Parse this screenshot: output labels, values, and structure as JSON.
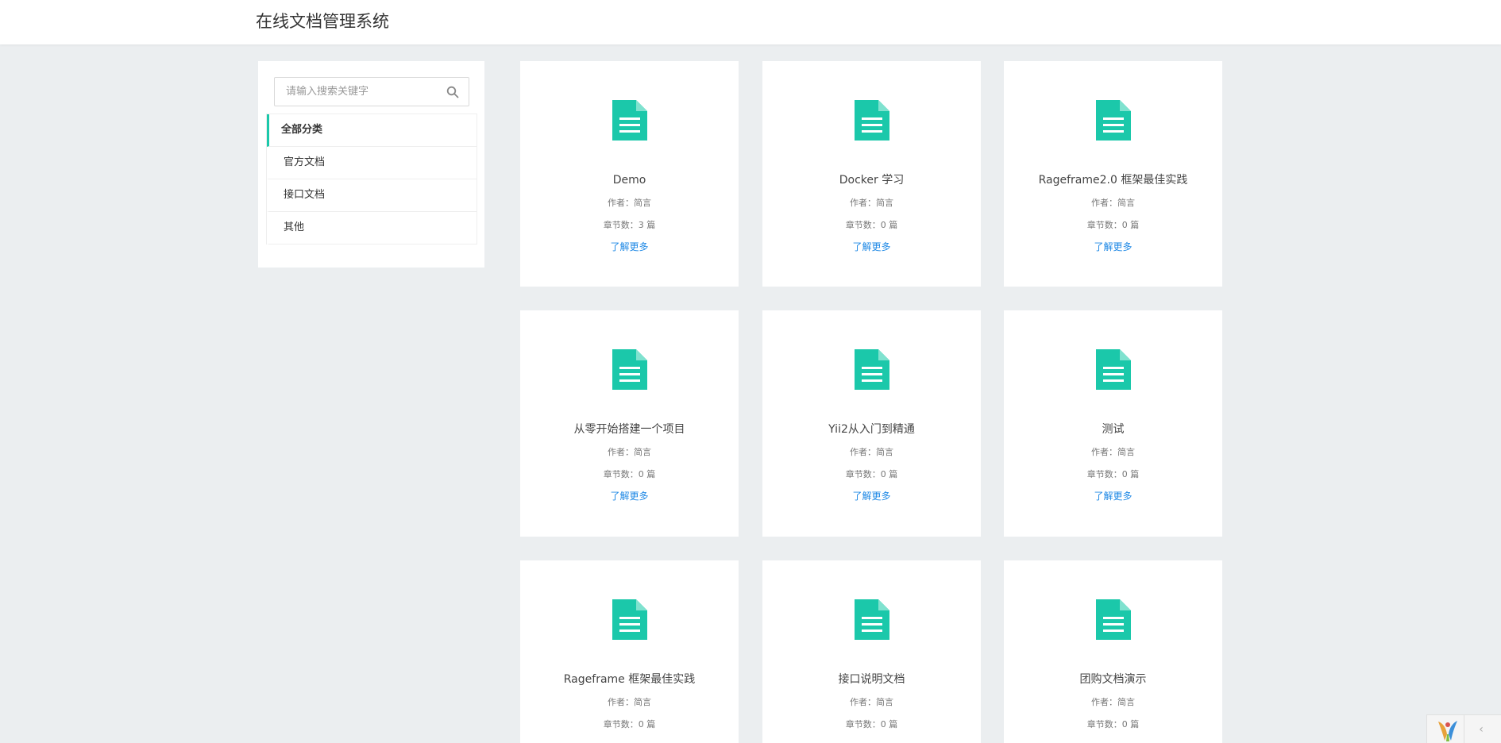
{
  "header": {
    "title": "在线文档管理系统"
  },
  "sidebar": {
    "search_placeholder": "请输入搜索关键字",
    "search_icon": "search-icon",
    "categories": [
      {
        "label": "全部分类",
        "active": true
      },
      {
        "label": "官方文档",
        "active": false
      },
      {
        "label": "接口文档",
        "active": false
      },
      {
        "label": "其他",
        "active": false
      }
    ]
  },
  "accent_color": "#1bc8aa",
  "link_color": "#1e88e5",
  "cards": [
    {
      "title": "Demo",
      "author": "作者：简言",
      "chapters": "章节数：3 篇",
      "more": "了解更多"
    },
    {
      "title": "Docker 学习",
      "author": "作者：简言",
      "chapters": "章节数：0 篇",
      "more": "了解更多"
    },
    {
      "title": "Rageframe2.0 框架最佳实践",
      "author": "作者：简言",
      "chapters": "章节数：0 篇",
      "more": "了解更多"
    },
    {
      "title": "从零开始搭建一个项目",
      "author": "作者：简言",
      "chapters": "章节数：0 篇",
      "more": "了解更多"
    },
    {
      "title": "Yii2从入门到精通",
      "author": "作者：简言",
      "chapters": "章节数：0 篇",
      "more": "了解更多"
    },
    {
      "title": "测试",
      "author": "作者：简言",
      "chapters": "章节数：0 篇",
      "more": "了解更多"
    },
    {
      "title": "Rageframe 框架最佳实践",
      "author": "作者：简言",
      "chapters": "章节数：0 篇",
      "more": ""
    },
    {
      "title": "接口说明文档",
      "author": "作者：简言",
      "chapters": "章节数：0 篇",
      "more": ""
    },
    {
      "title": "团购文档演示",
      "author": "作者：简言",
      "chapters": "章节数：0 篇",
      "more": ""
    }
  ],
  "corner": {
    "logo_icon": "yii-logo-icon",
    "chevron": "‹"
  }
}
